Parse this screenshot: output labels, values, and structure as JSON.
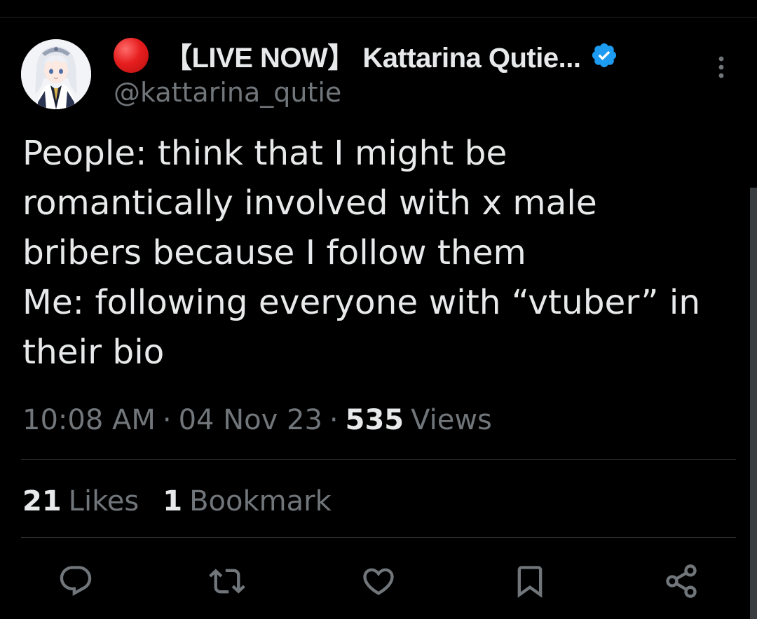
{
  "tweet": {
    "author": {
      "display_name": "【LIVE NOW】 Kattarina Qutie...",
      "handle": "@kattarina_qutie",
      "verified": true,
      "live_indicator_color": "#e61e1e",
      "verified_color": "#1d9bf0"
    },
    "text": "People: think that I might be\nromantically involved with x male\nbribers because I follow them\nMe: following everyone with “vtuber” in\ntheir bio",
    "time": "10:08 AM",
    "date": "04 Nov 23",
    "separator": "·",
    "views_count": "535",
    "views_label": "Views",
    "likes_count": "21",
    "likes_label": "Likes",
    "bookmarks_count": "1",
    "bookmarks_label": "Bookmark"
  },
  "actions": [
    {
      "name": "reply",
      "icon": "reply-icon"
    },
    {
      "name": "retweet",
      "icon": "retweet-icon"
    },
    {
      "name": "like",
      "icon": "heart-icon"
    },
    {
      "name": "bookmark",
      "icon": "bookmark-icon"
    },
    {
      "name": "share",
      "icon": "share-icon"
    }
  ],
  "colors": {
    "background": "#000000",
    "text_primary": "#e7e9ea",
    "text_secondary": "#71767b",
    "divider": "#2f3336"
  }
}
